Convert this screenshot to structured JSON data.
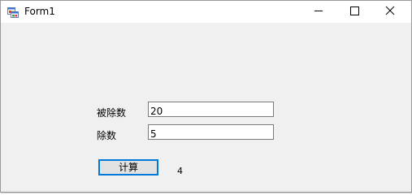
{
  "window": {
    "title": "Form1",
    "icon": "winforms-app-icon",
    "controls": {
      "minimize": "minimize-icon",
      "maximize": "maximize-icon",
      "close": "close-icon"
    }
  },
  "form": {
    "dividend_label": "被除数",
    "dividend_value": "20",
    "divisor_label": "除数",
    "divisor_value": "5",
    "calculate_button": "计算",
    "result": "4"
  },
  "colors": {
    "form_background": "#f0f0f0",
    "button_focus_border": "#0078d7",
    "button_face": "#e1e1e1",
    "textbox_border": "#7a7a7a"
  }
}
